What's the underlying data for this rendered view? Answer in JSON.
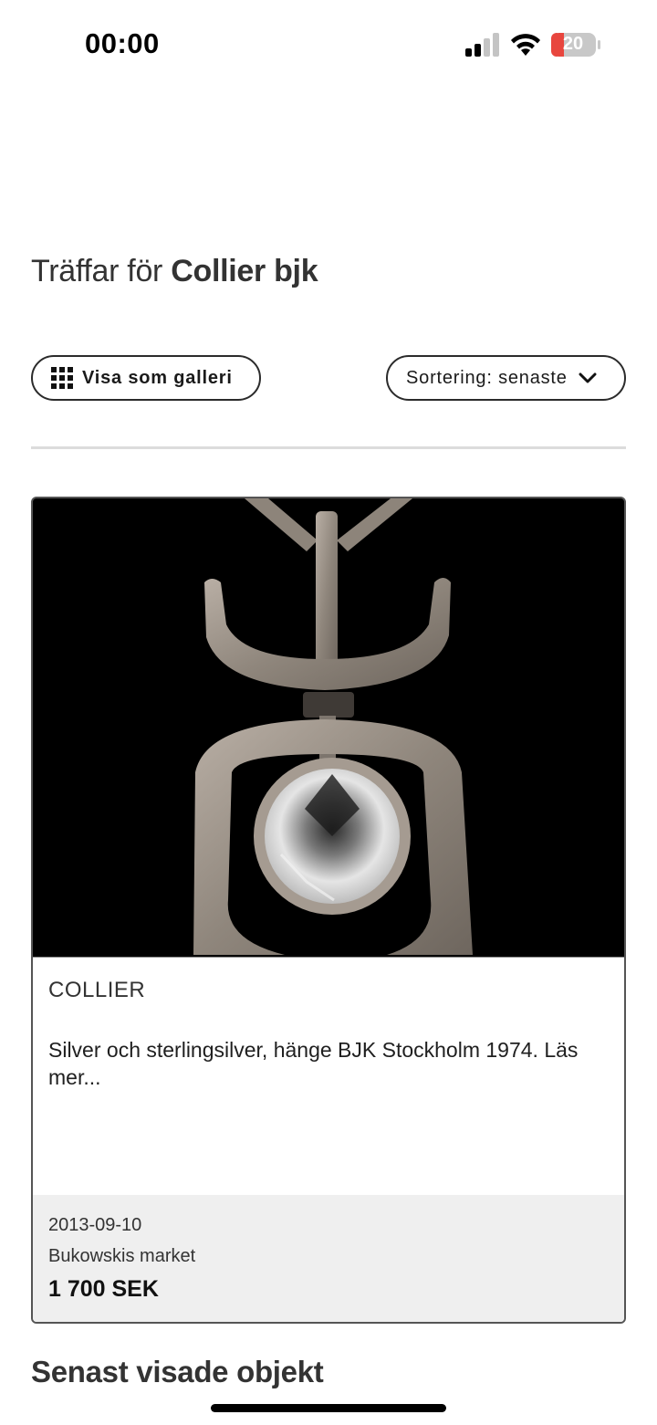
{
  "status_bar": {
    "time": "00:00",
    "battery": "20"
  },
  "search": {
    "heading_prefix": "Träffar för",
    "query": "Collier bjk"
  },
  "toolbar": {
    "gallery_label": "Visa som galleri",
    "sort_label": "Sortering: senaste"
  },
  "results": [
    {
      "title": "COLLIER",
      "description": "Silver och sterlingsilver, hänge BJK Stockholm 1974. Läs mer...",
      "date": "2013-09-10",
      "seller": "Bukowskis market",
      "price": "1 700 SEK"
    }
  ],
  "recent": {
    "heading": "Senast visade objekt"
  },
  "colors": {
    "battery_low": "#e8463e",
    "card_footer": "#efefef",
    "image_background": "#000000"
  }
}
